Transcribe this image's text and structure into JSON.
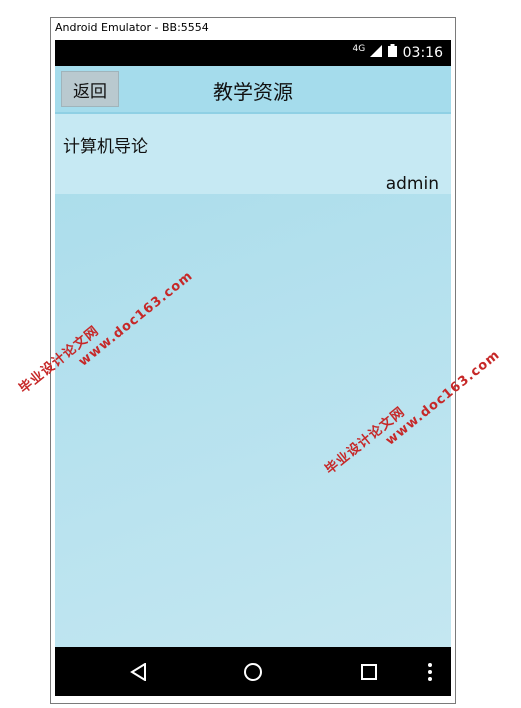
{
  "window": {
    "title": "Android Emulator - BB:5554"
  },
  "status_bar": {
    "signal_label": "4G",
    "time": "03:16"
  },
  "action_bar": {
    "back_label": "返回",
    "title": "教学资源"
  },
  "resources": [
    {
      "title": "计算机导论",
      "author": "admin"
    }
  ],
  "watermarks": [
    {
      "line1": "毕业设计论文网",
      "line2": "www.doc163.com"
    },
    {
      "line1": "毕业设计论文网",
      "line2": "www.doc163.com"
    }
  ],
  "nav_bar": {
    "back_icon": "back-triangle-icon",
    "home_icon": "home-circle-icon",
    "recents_icon": "recents-square-icon",
    "menu_icon": "overflow-menu-icon"
  },
  "colors": {
    "action_bar": "#a5dcec",
    "content_bg": "#b5e1ee",
    "list_item": "#c6e9f3",
    "watermark": "#c62828"
  }
}
